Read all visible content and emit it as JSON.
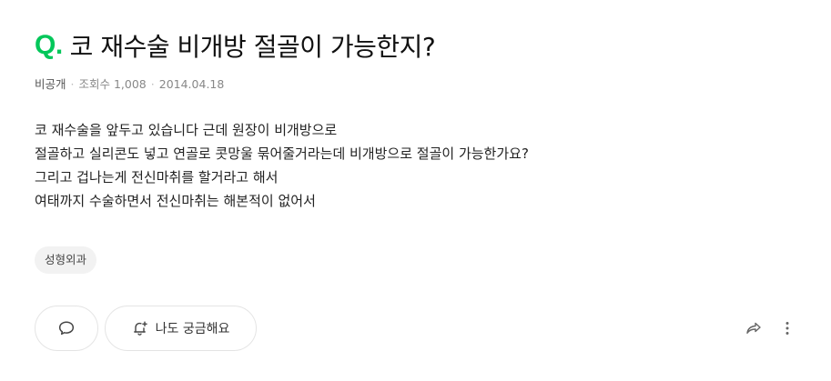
{
  "question": {
    "mark": "Q.",
    "title": "코 재수술 비개방 절골이 가능한지?"
  },
  "meta": {
    "author": "비공개",
    "views": "조회수 1,008",
    "date": "2014.04.18"
  },
  "body": {
    "lines": [
      "코 재수술을 앞두고 있습니다 근데 원장이 비개방으로",
      "절골하고 실리콘도 넣고 연골로 콧망울 묶어줄거라는데 비개방으로 절골이 가능한가요?",
      "그리고 겁나는게 전신마취를 할거라고 해서",
      "여태까지 수술하면서 전신마취는 해본적이 없어서"
    ]
  },
  "tags": [
    "성형외과"
  ],
  "actions": {
    "comment_icon": "comment-bubble-icon",
    "curious_icon": "bell-plus-icon",
    "curious_label": "나도 궁금해요",
    "share_icon": "share-arrow-icon",
    "more_icon": "more-vertical-icon"
  },
  "colors": {
    "accent": "#03c75a",
    "meta_text": "#888888",
    "tag_bg": "#f2f2f2",
    "border": "#e4e4e4"
  }
}
